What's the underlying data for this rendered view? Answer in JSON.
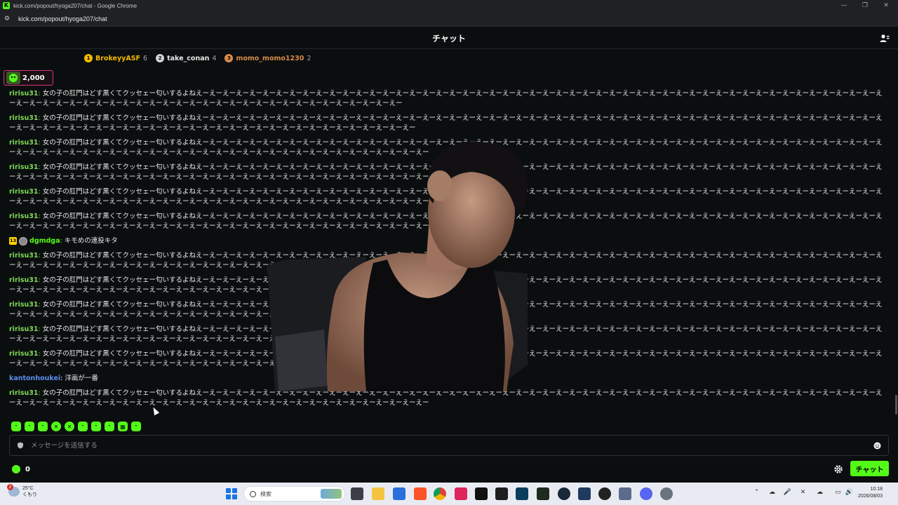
{
  "browser": {
    "window_title": "kick.com/popout/hyoga207/chat - Google Chrome",
    "favicon_letter": "K",
    "url": "kick.com/popout/hyoga207/chat"
  },
  "header": {
    "title": "チャット"
  },
  "leaderboard": [
    {
      "rank": "1",
      "name": "BrokeyyASF",
      "count": "6",
      "color": "#f5b800"
    },
    {
      "rank": "2",
      "name": "take_conan",
      "count": "4",
      "color": "#cfd3d8"
    },
    {
      "rank": "3",
      "name": "momo_momo1230",
      "count": "2",
      "color": "#d98b4a"
    }
  ],
  "gift": {
    "amount": "2,000"
  },
  "messages": [
    {
      "user": "ririsu31",
      "user_color": "#7ed957",
      "text": "女の子の肛門はどす黒くてクッセェー匂いするよねえーえーえーえーえーえーえーえーえーえーえーえーえーえーえーえーえーえーえーえーえーえーえーえーえーえーえーえーえーえーえーえーえーえーえーえーえーえーえーえーえーえーえーえーえーえーえーえーえーえーえーえーえーえーえーえーえーえーえーえーえーえーえーえーえーえーえーえーえーえーえーえーえーえーえーえーえーえーえーえーえー"
    },
    {
      "user": "ririsu31",
      "user_color": "#7ed957",
      "text": "女の子の肛門はどす黒くてクッセェー匂いするよねえーえーえーえーえーえーえーえーえーえーえーえーえーえーえーえーえーえーえーえーえーえーえーえーえーえーえーえーえーえーえーえーえーえーえーえーえーえーえーえーえーえーえーえーえーえーえーえーえーえーえーえーえーえーえーえーえーえーえーえーえーえーえーえーえーえーえーえーえーえーえーえーえーえーえーえーえーえーえーえーえーえー"
    },
    {
      "user": "ririsu31",
      "user_color": "#7ed957",
      "text": "女の子の肛門はどす黒くてクッセェー匂いするよねえーえーえーえーえーえーえーえーえーえーえーえーえーえーえーえーえーえーえーえーえーえーえーえーえーえーえーえーえーえーえーえーえーえーえーえーえーえーえーえーえーえーえーえーえーえーえーえーえーえーえーえーえーえーえーえーえーえーえーえーえーえーえーえーえーえーえーえーえーえーえーえーえーえーえーえーえーえーえーえーえーえーえー"
    },
    {
      "user": "ririsu31",
      "user_color": "#7ed957",
      "text": "女の子の肛門はどす黒くてクッセェー匂いするよねえーえーえーえーえーえーえーえーえーえーえーえーえーえーえーえーえーえーえーえーえーえーえーえーえーえーえーえーえーえーえーえーえーえーえーえーえーえーえーえーえーえーえーえーえーえーえーえーえーえーえーえーえーえーえーえーえーえーえーえーえーえーえーえーえーえーえーえーえーえーえーえーえーえーえーえーえーえーえーえーえーえーえー"
    },
    {
      "user": "ririsu31",
      "user_color": "#7ed957",
      "text": "女の子の肛門はどす黒くてクッセェー匂いするよねえーえーえーえーえーえーえーえーえーえーえーえーえーえーえーえーえーえーえーえーえーえーえーえーえーえーえーえーえーえーえーえーえーえーえーえーえーえーえーえーえーえーえーえーえーえーえーえーえーえーえーえーえーえーえーえーえーえーえーえーえーえーえーえーえーえーえーえーえーえーえーえーえーえーえーえーえーえーえーえーえーえーえー"
    },
    {
      "user": "ririsu31",
      "user_color": "#7ed957",
      "text": "女の子の肛門はどす黒くてクッセェー匂いするよねえーえーえーえーえーえーえーえーえーえーえーえーえーえーえーえーえーえーえーえーえーえーえーえーえーえーえーえーえーえーえーえーえーえーえーえーえーえーえーえーえーえーえーえーえーえーえーえーえーえーえーえーえーえーえーえーえーえーえーえーえーえーえーえーえーえーえーえーえーえーえーえーえーえーえーえーえーえーえーえーえーえーえー"
    },
    {
      "user": "dgmdga",
      "user_color": "#53fc18",
      "badge_num": "13",
      "text": "キモめの連投キタ"
    },
    {
      "user": "ririsu31",
      "user_color": "#7ed957",
      "text": "女の子の肛門はどす黒くてクッセェー匂いするよねえーえーえーえーえーえーえーえーえーえーえーえーえーえーえーえーえーえーえーえーえーえーえーえーえーえーえーえーえーえーえーえーえーえーえーえーえーえーえーえーえーえーえーえーえーえーえーえーえーえーえーえーえーえーえーえーえーえーえーえーえーえーえーえーえーえーえーえーえーえーえーえーえーえーえーえーえーえーえーえーえーえーえー"
    },
    {
      "user": "ririsu31",
      "user_color": "#7ed957",
      "text": "女の子の肛門はどす黒くてクッセェー匂いするよねえーえーえーえーえーえーえーえーえーえーえーえーえーえーえーえーえーえーえーえーえーえーえーえーえーえーえーえーえーえーえーえーえーえーえーえーえーえーえーえーえーえーえーえーえーえーえーえーえーえーえーえーえーえーえーえーえーえーえーえーえーえーえーえーえーえーえーえーえーえーえーえーえーえーえーえーえーえーえーえーえーえーえー"
    },
    {
      "user": "ririsu31",
      "user_color": "#7ed957",
      "text": "女の子の肛門はどす黒くてクッセェー匂いするよねえーえーえーえーえーえーえーえーえーえーえーえーえーえーえーえーえーえーえーえーえーえーえーえーえーえーえーえーえーえーえーえーえーえーえーえーえーえーえーえーえーえーえーえーえーえーえーえーえーえーえーえーえーえーえーえーえーえーえーえーえーえーえーえーえーえーえーえーえーえーえーえーえーえーえーえーえーえーえーえーえーえーえー"
    },
    {
      "user": "ririsu31",
      "user_color": "#7ed957",
      "text": "女の子の肛門はどす黒くてクッセェー匂いするよねえーえーえーえーえーえーえーえーえーえーえーえーえーえーえーえーえーえーえーえーえーえーえーえーえーえーえーえーえーえーえーえーえーえーえーえーえーえーえーえーえーえーえーえーえーえーえーえーえーえーえーえーえーえーえーえーえーえーえーえーえーえーえーえーえーえーえーえーえーえーえーえーえーえーえーえーえーえーえーえーえーえーえー"
    },
    {
      "user": "ririsu31",
      "user_color": "#7ed957",
      "text": "女の子の肛門はどす黒くてクッセェー匂いするよねえーえーえーえーえーえーえーえーえーえーえーえーえーえーえーえーえーえーえーえーえーえーえーえーえーえーえーえーえーえーえーえーえーえーえーえーえーえーえーえーえーえーえーえーえーえーえーえーえーえーえーえーえーえーえーえーえーえーえーえーえーえーえーえーえーえーえーえーえーえーえーえーえーえーえーえーえーえーえーえーえーえーえー"
    },
    {
      "user": "kantonhoukei",
      "user_color": "#5b8def",
      "text": "洋画が一番"
    },
    {
      "user": "ririsu31",
      "user_color": "#7ed957",
      "text": "女の子の肛門はどす黒くてクッセェー匂いするよねえーえーえーえーえーえーえーえーえーえーえーえーえーえーえーえーえーえーえーえーえーえーえーえーえーえーえーえーえーえーえーえーえーえーえーえーえーえーえーえーえーえーえーえーえーえーえーえーえーえーえーえーえーえーえーえーえーえーえーえーえーえーえーえーえーえーえーえーえーえーえーえーえーえーえーえーえーえーえーえーえーえーえー"
    }
  ],
  "input": {
    "placeholder": "メッセージを送信する"
  },
  "footer": {
    "points": "0",
    "send_label": "チャット"
  },
  "taskbar": {
    "weather_temp": "25°C",
    "weather_desc": "くもり",
    "weather_badge": "2",
    "search_label": "検索",
    "time": "10:18",
    "date": "2026/08/03"
  }
}
